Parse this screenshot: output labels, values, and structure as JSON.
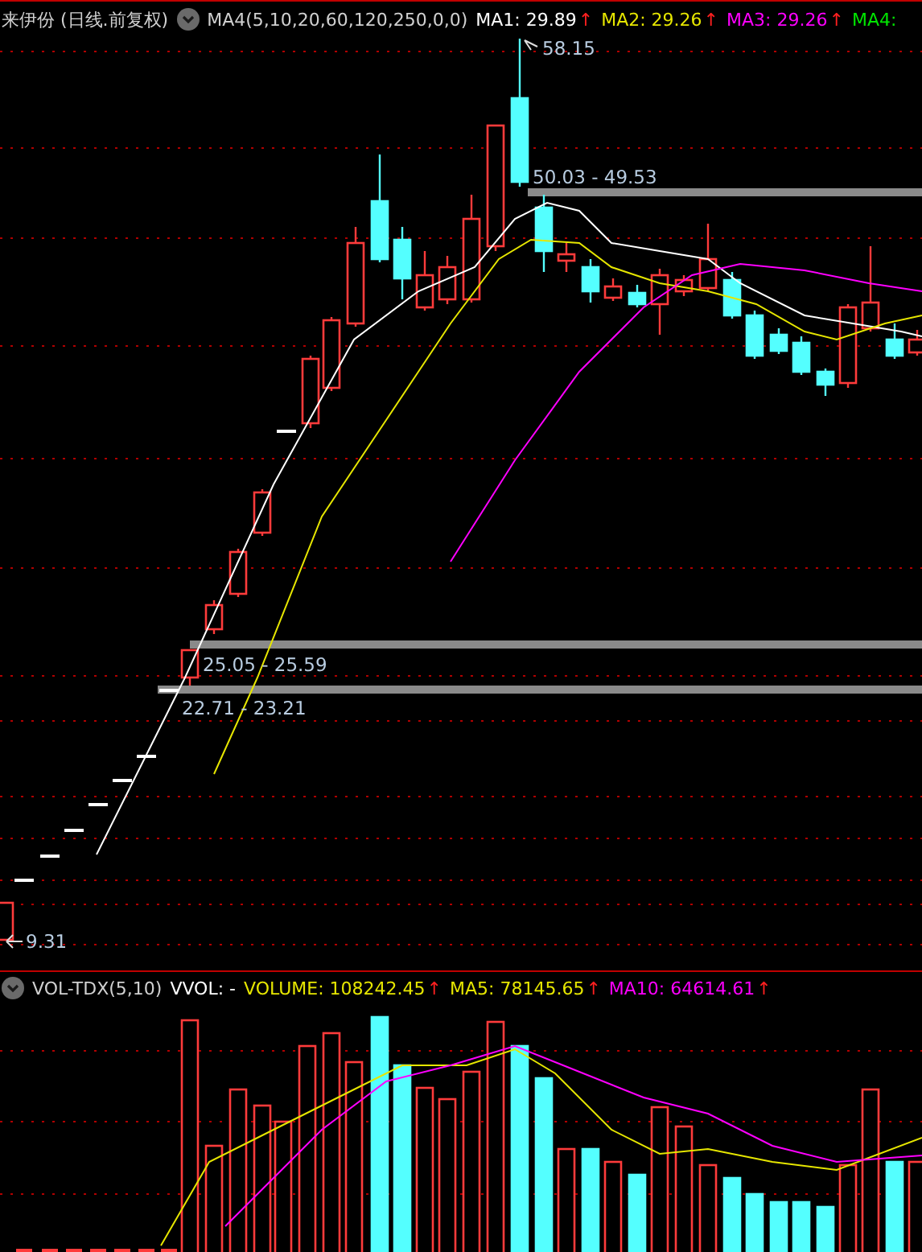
{
  "main_pane": {
    "title": "来伊份 (日线.前复权)",
    "indicator": "MA4(5,10,20,60,120,250,0,0)",
    "values": [
      {
        "label": "MA1: 29.89",
        "arrow": "↑",
        "color": "#ffffff"
      },
      {
        "label": "MA2: 29.26",
        "arrow": "↑",
        "color": "#e6e600"
      },
      {
        "label": "MA3: 29.26",
        "arrow": "↑",
        "color": "#ff00ff"
      },
      {
        "label": "MA4:",
        "color": "#00e600"
      }
    ],
    "price_labels": [
      "58.15",
      "50.03 - 49.53",
      "25.05 - 25.59",
      "22.71 - 23.21",
      "9.31"
    ]
  },
  "volume_pane": {
    "indicator": "VOL-TDX(5,10)",
    "values": [
      {
        "label": "VVOL: -",
        "color": "#ffffff"
      },
      {
        "label": "VOLUME: 108242.45",
        "arrow": "↑",
        "color": "#e6e600"
      },
      {
        "label": "MA5: 78145.65",
        "arrow": "↑",
        "color": "#e6e600"
      },
      {
        "label": "MA10: 64614.61",
        "arrow": "↑",
        "color": "#ff00ff"
      }
    ]
  }
}
